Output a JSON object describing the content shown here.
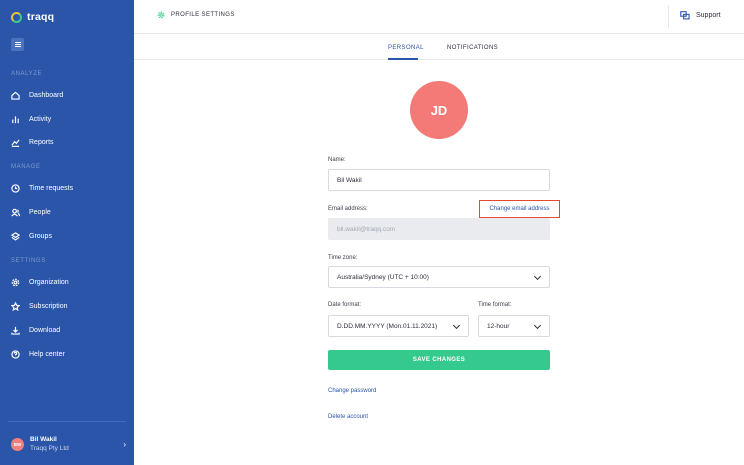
{
  "sidebar": {
    "brand": "traqq",
    "sections": {
      "analyze": "ANALYZE",
      "manage": "MANAGE",
      "settings": "SETTINGS"
    },
    "items": {
      "dashboard": "Dashboard",
      "activity": "Activity",
      "reports": "Reports",
      "time_requests": "Time requests",
      "people": "People",
      "groups": "Groups",
      "organization": "Organization",
      "subscription": "Subscription",
      "download": "Download",
      "help_center": "Help center"
    },
    "user": {
      "initials": "BW",
      "name": "Bil Wakil",
      "company": "Traqq Pty Ltd"
    }
  },
  "header": {
    "title": "PROFILE SETTINGS",
    "support": "Support"
  },
  "tabs": {
    "personal": "PERSONAL",
    "notifications": "NOTIFICATIONS"
  },
  "profile": {
    "avatar_initials": "JD",
    "name_label": "Name:",
    "name_value": "Bil Wakil",
    "email_label": "Email address:",
    "change_email": "Change email address",
    "email_value": "bil.wakil@traqq.com",
    "timezone_label": "Time zone:",
    "timezone_value": "Australia/Sydney (UTC + 10:00)",
    "date_format_label": "Date format:",
    "date_format_value": "D.DD.MM.YYYY (Mon.01.11.2021)",
    "time_format_label": "Time format:",
    "time_format_value": "12-hour",
    "save": "SAVE CHANGES",
    "change_password": "Change password",
    "delete_account": "Delete account"
  },
  "colors": {
    "sidebar": "#2b55a8",
    "accent": "#35c98e",
    "avatar": "#f47a78",
    "highlight": "#e2492f"
  }
}
